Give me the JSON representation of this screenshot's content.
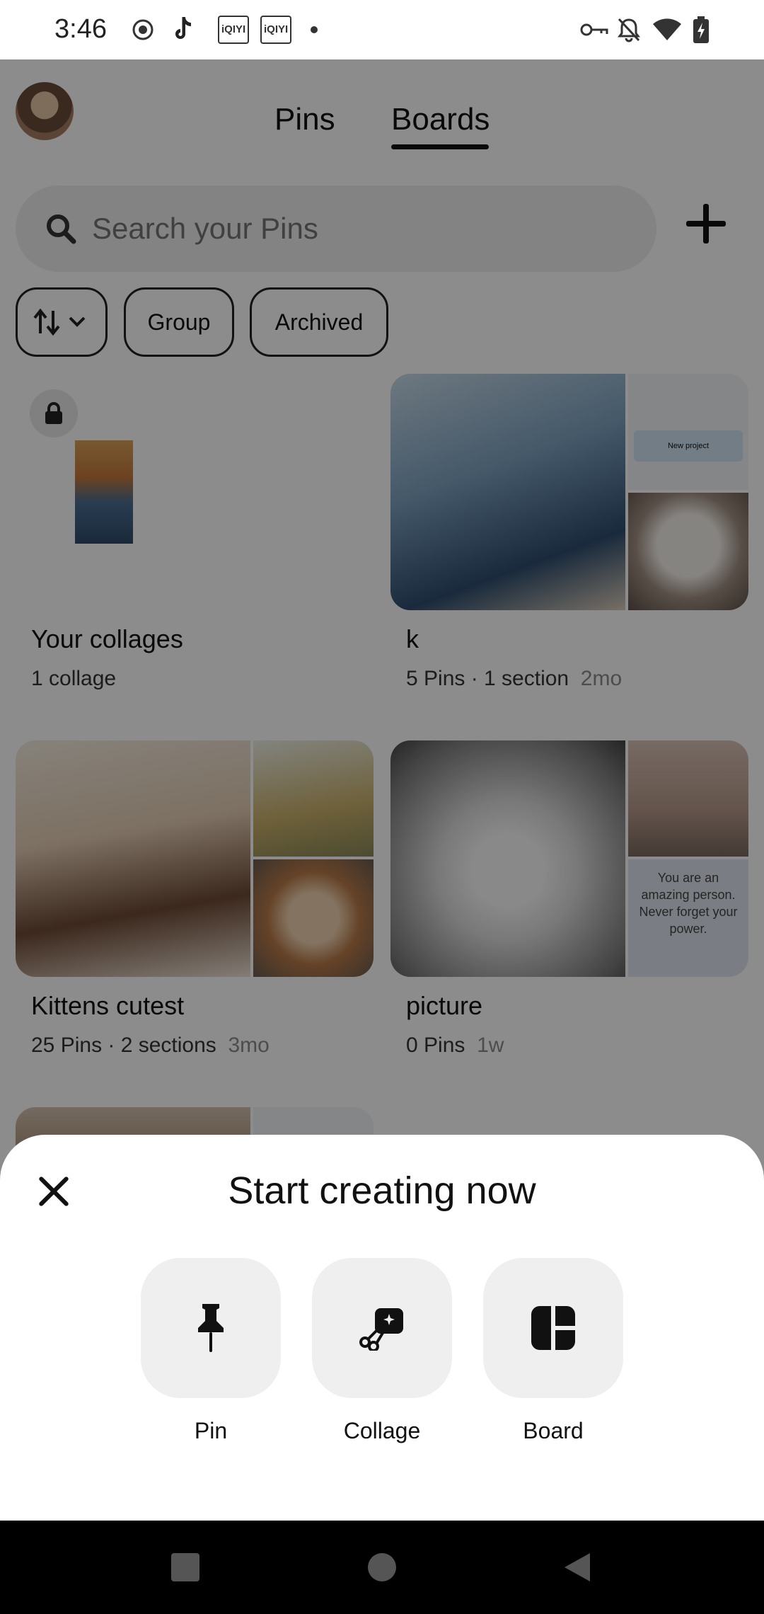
{
  "status_bar": {
    "time": "3:46",
    "left_icons": [
      "record-icon",
      "tiktok-icon",
      "iqiyi-icon",
      "iqiyi-icon",
      "dot-icon"
    ],
    "iqiyi_label": "iQIYI",
    "right_icons": [
      "vpn-key-icon",
      "bell-off-icon",
      "wifi-icon",
      "battery-charging-icon"
    ]
  },
  "header": {
    "tabs": [
      {
        "label": "Pins",
        "active": false
      },
      {
        "label": "Boards",
        "active": true
      }
    ]
  },
  "search": {
    "placeholder": "Search your Pins"
  },
  "filters": {
    "chips": [
      "Group",
      "Archived"
    ]
  },
  "boards": [
    {
      "title": "Your collages",
      "meta": "1 collage",
      "ago": ""
    },
    {
      "title": "k",
      "meta": "5 Pins · 1 section",
      "ago": "2mo"
    },
    {
      "title": "Kittens cutest",
      "meta": "25 Pins · 2 sections",
      "ago": "3mo"
    },
    {
      "title": "picture",
      "meta": "0 Pins",
      "ago": "1w"
    }
  ],
  "picture_board_quote": "You are an amazing person. Never forget your power.",
  "k_board_button": "New project",
  "sheet": {
    "title": "Start creating now",
    "options": [
      {
        "label": "Pin",
        "icon": "pushpin-icon"
      },
      {
        "label": "Collage",
        "icon": "scissors-collage-icon"
      },
      {
        "label": "Board",
        "icon": "board-grid-icon"
      }
    ]
  },
  "colors": {
    "scrim": "#000000",
    "option_bg": "#efefef",
    "text": "#111111"
  }
}
